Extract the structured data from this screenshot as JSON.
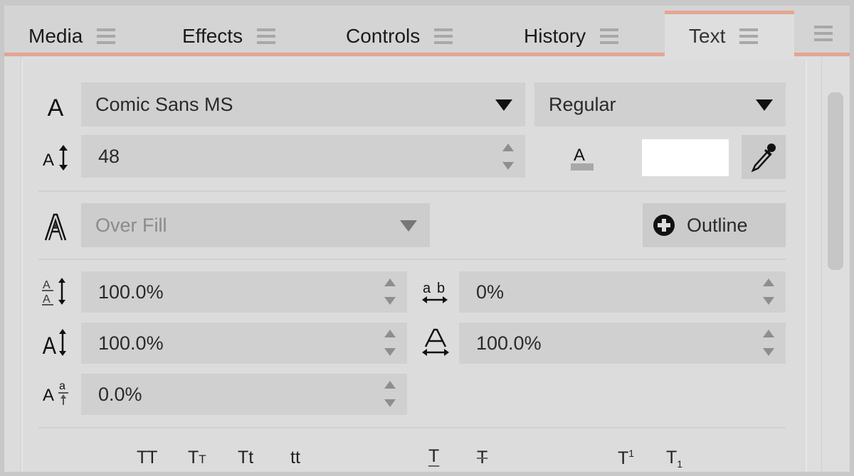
{
  "tabs": [
    {
      "label": "Media",
      "active": false
    },
    {
      "label": "Effects",
      "active": false
    },
    {
      "label": "Controls",
      "active": false
    },
    {
      "label": "History",
      "active": false
    },
    {
      "label": "Text",
      "active": true
    }
  ],
  "text_panel": {
    "font_family": {
      "value": "Comic Sans MS",
      "icon": "font-icon"
    },
    "font_style": {
      "value": "Regular"
    },
    "font_size": {
      "value": "48",
      "icon": "font-size-icon"
    },
    "fill_color": {
      "icon": "text-color-icon",
      "swatch": "#ffffff"
    },
    "eyedropper": {
      "icon": "eyedropper-icon"
    },
    "outline_mode": {
      "value": "Over Fill",
      "disabled": true,
      "icon": "outline-text-icon"
    },
    "outline_button": {
      "label": "Outline",
      "icon": "plus-circle-icon"
    },
    "line_spacing": {
      "value": "100.0%",
      "icon": "line-spacing-icon"
    },
    "letter_spacing": {
      "value": "0%",
      "icon": "letter-spacing-icon"
    },
    "vertical_scale": {
      "value": "100.0%",
      "icon": "vertical-scale-icon"
    },
    "horizontal_scale": {
      "value": "100.0%",
      "icon": "horizontal-scale-icon"
    },
    "baseline_shift": {
      "value": "0.0%",
      "icon": "baseline-shift-icon"
    },
    "text_styles": {
      "all_caps": "TT",
      "small_caps": "T",
      "small_caps_sub": "T",
      "title_case": "Tt",
      "lower_case": "tt",
      "underline": "T",
      "strikethrough": "T",
      "superscript": "T",
      "superscript_sup": "1",
      "subscript": "T",
      "subscript_sub": "1"
    }
  },
  "colors": {
    "accent": "#e3a592",
    "panel": "#dedede",
    "field": "#d0d0d0"
  }
}
